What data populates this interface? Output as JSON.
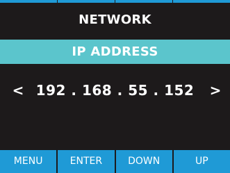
{
  "header": {
    "title": "NETWORK"
  },
  "section": {
    "label": "IP ADDRESS"
  },
  "value": {
    "prev_arrow": "<",
    "ip_address": "192 . 168 . 55 . 152",
    "next_arrow": ">"
  },
  "footer": {
    "buttons": [
      {
        "label": "MENU"
      },
      {
        "label": "ENTER"
      },
      {
        "label": "DOWN"
      },
      {
        "label": "UP"
      }
    ]
  },
  "colors": {
    "background": "#1d1a1b",
    "accent_blue": "#1f9ad6",
    "accent_teal": "#5bc5cc",
    "text": "#ffffff"
  }
}
